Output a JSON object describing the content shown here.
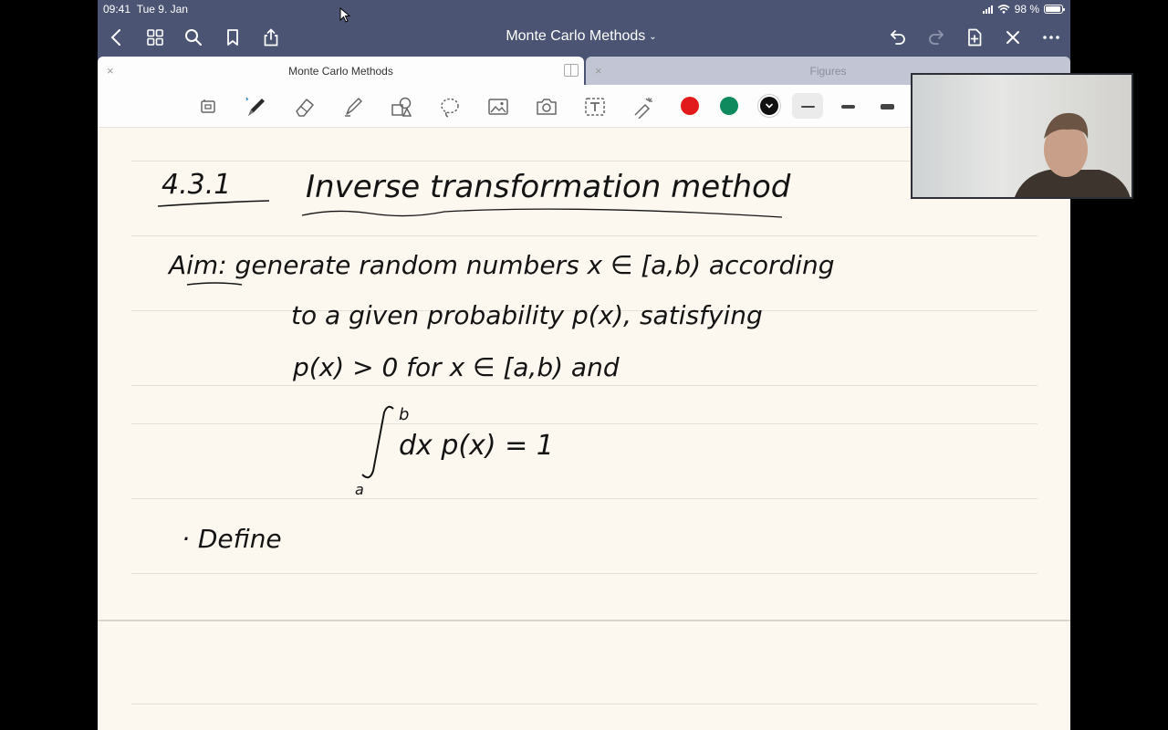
{
  "status_bar": {
    "time": "09:41",
    "date": "Tue 9. Jan",
    "battery": "98 %"
  },
  "navbar": {
    "title": "Monte Carlo Methods"
  },
  "tabs": [
    {
      "label": "Monte Carlo Methods",
      "active": true
    },
    {
      "label": "Figures",
      "active": false
    }
  ],
  "toolbar": {
    "tools": [
      "lasso-select-icon",
      "pen-icon",
      "eraser-icon",
      "highlighter-icon",
      "shapes-icon",
      "lasso-icon",
      "image-icon",
      "camera-icon",
      "text-icon",
      "laser-pointer-icon"
    ],
    "colors": [
      "#e11b1b",
      "#0f8a5f",
      "#111111"
    ]
  },
  "note": {
    "section_number": "4.3.1",
    "heading": "Inverse transformation method",
    "line1": "Aim: generate random numbers x ∈ [a,b) according",
    "line2": "to a given probability p(x), satisfying",
    "line3": "p(x) > 0 for x ∈ [a,b) and",
    "integral_upper": "b",
    "integral_body": "dx   p(x) = 1",
    "integral_lower": "a",
    "define": "Define"
  }
}
